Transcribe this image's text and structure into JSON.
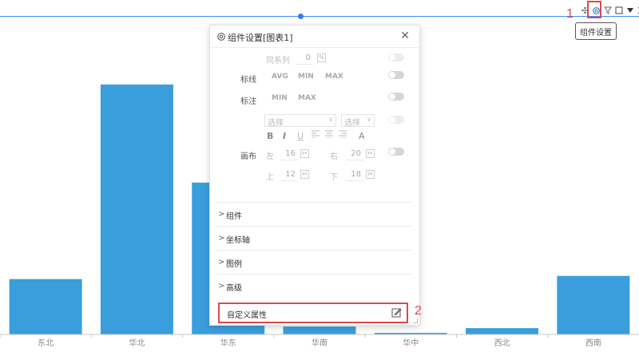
{
  "markers": {
    "step1": "1",
    "step2": "2"
  },
  "toolbar": {
    "tooltip": "组件设置"
  },
  "panel": {
    "title": "组件设置[图表1]",
    "same_series_label": "同系列",
    "same_series_value": "0",
    "same_series_unit": "%",
    "markline_label": "标线",
    "markline_opts": [
      "AVG",
      "MIN",
      "MAX"
    ],
    "annotation_label": "标注",
    "annotation_opts": [
      "MIN",
      "MAX"
    ],
    "select1_placeholder": "选择",
    "select2_placeholder": "选择",
    "format_buttons": [
      "B",
      "I",
      "U",
      "A"
    ],
    "canvas_label": "画布",
    "left_label": "左",
    "left_value": "16",
    "left_unit": "px",
    "right_label": "右",
    "right_value": "20",
    "right_unit": "px",
    "top_label": "上",
    "top_value": "12",
    "top_unit": "px",
    "bottom_label": "下",
    "bottom_value": "18",
    "bottom_unit": "px",
    "sections": [
      "组件",
      "坐标轴",
      "图例",
      "高级"
    ],
    "custom_props": "自定义属性"
  },
  "chart_data": {
    "type": "bar",
    "categories": [
      "东北",
      "华北",
      "华东",
      "华南",
      "华中",
      "西北",
      "西南"
    ],
    "values": [
      70,
      316,
      192,
      10,
      2,
      8,
      74
    ],
    "ylim": [
      0,
      330
    ],
    "bar_color": "#3a9edc",
    "axis_color": "#c8c8c8",
    "label_color": "#888888"
  }
}
